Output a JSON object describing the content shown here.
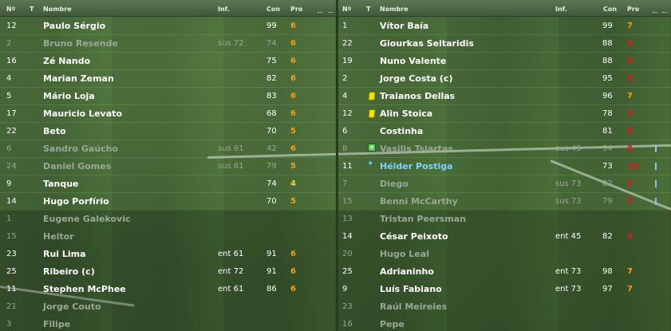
{
  "headers": {
    "num": "Nº",
    "t": "T",
    "name": "Nombre",
    "inf": "Inf.",
    "con": "Con",
    "pro": "Pro"
  },
  "colors": {
    "pro_orange": "#f0a020",
    "pro_yellow": "#f2d34a",
    "pro_red": "#d81e1e",
    "highlight_blue": "#7fd3ff"
  },
  "left_team": [
    {
      "num": "12",
      "name": "Paulo Sérgio",
      "inf": "",
      "con": "99",
      "pro": "6",
      "pro_color": "orange",
      "dim": false
    },
    {
      "num": "2",
      "name": "Bruno Resende",
      "inf": "sus 72",
      "con": "74",
      "pro": "6",
      "pro_color": "orange",
      "dim": true
    },
    {
      "num": "16",
      "name": "Zé Nando",
      "inf": "",
      "con": "75",
      "pro": "6",
      "pro_color": "orange",
      "dim": false
    },
    {
      "num": "4",
      "name": "Marian Zeman",
      "inf": "",
      "con": "82",
      "pro": "6",
      "pro_color": "orange",
      "dim": false
    },
    {
      "num": "5",
      "name": "Mário Loja",
      "inf": "",
      "con": "83",
      "pro": "6",
      "pro_color": "orange",
      "dim": false
    },
    {
      "num": "17",
      "name": "Mauricio Levato",
      "inf": "",
      "con": "68",
      "pro": "6",
      "pro_color": "orange",
      "dim": false
    },
    {
      "num": "22",
      "name": "Beto",
      "inf": "",
      "con": "70",
      "pro": "5",
      "pro_color": "orange",
      "dim": false
    },
    {
      "num": "6",
      "name": "Sandro Gaúcho",
      "inf": "sus 61",
      "con": "42",
      "pro": "6",
      "pro_color": "orange",
      "dim": true
    },
    {
      "num": "24",
      "name": "Daniel Gomes",
      "inf": "sus 61",
      "con": "79",
      "pro": "5",
      "pro_color": "orange",
      "dim": true
    },
    {
      "num": "9",
      "name": "Tanque",
      "inf": "",
      "con": "74",
      "pro": "4",
      "pro_color": "yellow",
      "dim": false
    },
    {
      "num": "14",
      "name": "Hugo Porfírio",
      "inf": "",
      "con": "70",
      "pro": "5",
      "pro_color": "orange",
      "dim": false
    },
    {
      "num": "1",
      "name": "Eugene Galekovic",
      "inf": "",
      "con": "",
      "pro": "",
      "pro_color": "",
      "dim": true
    },
    {
      "num": "15",
      "name": "Heitor",
      "inf": "",
      "con": "",
      "pro": "",
      "pro_color": "",
      "dim": true
    },
    {
      "num": "23",
      "name": "Rui Lima",
      "inf": "ent 61",
      "con": "91",
      "pro": "6",
      "pro_color": "orange",
      "dim": false
    },
    {
      "num": "25",
      "name": "Ribeiro (c)",
      "inf": "ent 72",
      "con": "91",
      "pro": "6",
      "pro_color": "orange",
      "dim": false
    },
    {
      "num": "11",
      "name": "Stephen McPhee",
      "inf": "ent 61",
      "con": "86",
      "pro": "6",
      "pro_color": "orange",
      "dim": false
    },
    {
      "num": "21",
      "name": "Jorge Couto",
      "inf": "",
      "con": "",
      "pro": "",
      "pro_color": "",
      "dim": true
    },
    {
      "num": "3",
      "name": "Filipe",
      "inf": "",
      "con": "",
      "pro": "",
      "pro_color": "",
      "dim": true
    }
  ],
  "right_team": [
    {
      "num": "1",
      "icon": "",
      "name": "Vítor Baía",
      "inf": "",
      "con": "99",
      "pro": "7",
      "pro_color": "orange",
      "dim": false,
      "mark": false
    },
    {
      "num": "22",
      "icon": "",
      "name": "Giourkas Seitaridis",
      "inf": "",
      "con": "88",
      "pro": "8",
      "pro_color": "red",
      "dim": false,
      "mark": false
    },
    {
      "num": "19",
      "icon": "",
      "name": "Nuno Valente",
      "inf": "",
      "con": "88",
      "pro": "8",
      "pro_color": "red",
      "dim": false,
      "mark": false
    },
    {
      "num": "2",
      "icon": "",
      "name": "Jorge Costa (c)",
      "inf": "",
      "con": "95",
      "pro": "8",
      "pro_color": "red",
      "dim": false,
      "mark": false
    },
    {
      "num": "4",
      "icon": "yellow-card-icon",
      "name": "Traianos Dellas",
      "inf": "",
      "con": "96",
      "pro": "7",
      "pro_color": "orange",
      "dim": false,
      "mark": false
    },
    {
      "num": "12",
      "icon": "yellow-card-icon",
      "name": "Alin Stoica",
      "inf": "",
      "con": "78",
      "pro": "9",
      "pro_color": "red",
      "dim": false,
      "mark": false
    },
    {
      "num": "6",
      "icon": "",
      "name": "Costinha",
      "inf": "",
      "con": "81",
      "pro": "8",
      "pro_color": "red",
      "dim": false,
      "mark": false
    },
    {
      "num": "8",
      "icon": "plus-icon",
      "name": "Vasilis Tsiartas",
      "inf": "sus 45",
      "con": "94",
      "pro": "8",
      "pro_color": "red",
      "dim": true,
      "mark": true
    },
    {
      "num": "11",
      "icon": "star-icon",
      "name": "Hélder Postiga",
      "inf": "",
      "con": "73",
      "pro": "10",
      "pro_color": "red",
      "dim": false,
      "mark": true,
      "highlight": true
    },
    {
      "num": "7",
      "icon": "",
      "name": "Diego",
      "inf": "sus 73",
      "con": "82",
      "pro": "9",
      "pro_color": "red",
      "dim": true,
      "mark": true
    },
    {
      "num": "15",
      "icon": "",
      "name": "Benni McCarthy",
      "inf": "sus 73",
      "con": "79",
      "pro": "9",
      "pro_color": "red",
      "dim": true,
      "mark": true
    },
    {
      "num": "13",
      "icon": "",
      "name": "Tristan Peersman",
      "inf": "",
      "con": "",
      "pro": "",
      "pro_color": "",
      "dim": true,
      "mark": false
    },
    {
      "num": "14",
      "icon": "",
      "name": "César Peixoto",
      "inf": "ent 45",
      "con": "82",
      "pro": "9",
      "pro_color": "red",
      "dim": false,
      "mark": false
    },
    {
      "num": "20",
      "icon": "",
      "name": "Hugo Leal",
      "inf": "",
      "con": "",
      "pro": "",
      "pro_color": "",
      "dim": true,
      "mark": false
    },
    {
      "num": "25",
      "icon": "",
      "name": "Adrianinho",
      "inf": "ent 73",
      "con": "98",
      "pro": "7",
      "pro_color": "orange",
      "dim": false,
      "mark": false
    },
    {
      "num": "9",
      "icon": "",
      "name": "Luís Fabiano",
      "inf": "ent 73",
      "con": "97",
      "pro": "7",
      "pro_color": "orange",
      "dim": false,
      "mark": false
    },
    {
      "num": "23",
      "icon": "",
      "name": "Raúl Meireles",
      "inf": "",
      "con": "",
      "pro": "",
      "pro_color": "",
      "dim": true,
      "mark": false
    },
    {
      "num": "16",
      "icon": "",
      "name": "Pepe",
      "inf": "",
      "con": "",
      "pro": "",
      "pro_color": "",
      "dim": true,
      "mark": false
    }
  ]
}
